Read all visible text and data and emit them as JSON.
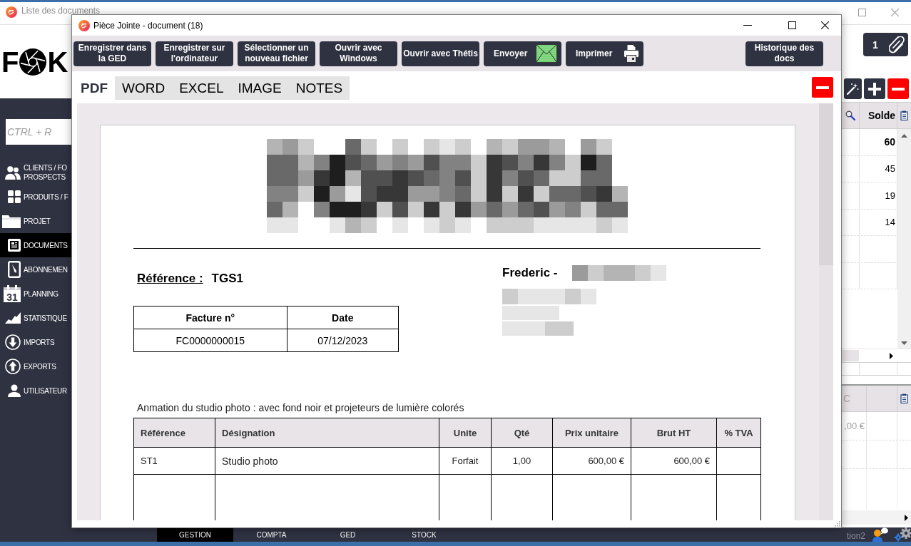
{
  "background_window": {
    "title": "Liste des documents",
    "logo": {
      "text_start": "F",
      "text_end": "K"
    },
    "search": {
      "placeholder": "CTRL + R"
    },
    "sidebar": {
      "items": [
        {
          "label": "CLIENTS / FO\nPROSPECTS",
          "selected": false
        },
        {
          "label": "PRODUITS / F",
          "selected": false
        },
        {
          "label": "PROJET",
          "selected": false
        },
        {
          "label": "DOCUMENTS",
          "selected": true
        },
        {
          "label": "ABONNEMEN",
          "selected": false
        },
        {
          "label": "PLANNING",
          "icon_text": "31",
          "selected": false
        },
        {
          "label": "STATISTIQUE",
          "selected": false
        },
        {
          "label": "IMPORTS",
          "selected": false
        },
        {
          "label": "EXPORTS",
          "selected": false
        },
        {
          "label": "UTILISATEUR",
          "selected": false
        }
      ]
    },
    "attachments_button": {
      "count": "1"
    },
    "grid": {
      "columns": [
        "Solde"
      ],
      "rows": [
        {
          "value": "60",
          "selected": true
        },
        {
          "value": "45",
          "selected": false
        },
        {
          "value": "19",
          "selected": false
        },
        {
          "value": "14",
          "selected": false
        }
      ]
    },
    "lower_grid": {
      "columns": [
        "C"
      ],
      "rows": [
        ",00 €"
      ]
    },
    "bottom_tabs": [
      {
        "label": "GESTION",
        "selected": true
      },
      {
        "label": "COMPTA",
        "selected": false
      },
      {
        "label": "GED",
        "selected": false
      },
      {
        "label": "STOCK",
        "selected": false
      }
    ],
    "status_text": "tion2"
  },
  "dialog": {
    "title": "Pièce Jointe - document (18)",
    "toolbar": {
      "buttons": [
        "Enregistrer dans la GED",
        "Enregistrer sur l'ordinateur",
        "Sélectionner un nouveau fichier",
        "Ouvrir avec Windows",
        "Ouvrir avec Thétis",
        "Envoyer",
        "Imprimer"
      ],
      "history_button": "Historique des docs"
    },
    "tabs": [
      {
        "label": "PDF",
        "selected": true
      },
      {
        "label": "WORD",
        "selected": false
      },
      {
        "label": "EXCEL",
        "selected": false
      },
      {
        "label": "IMAGE",
        "selected": false
      },
      {
        "label": "NOTES",
        "selected": false
      }
    ],
    "document": {
      "reference_label": "Référence :",
      "reference": "TGS1",
      "recipient_name": "Frederic -",
      "invoice_table": {
        "columns": [
          "Facture n°",
          "Date"
        ],
        "rows": [
          [
            "FC0000000015",
            "07/12/2023"
          ]
        ]
      },
      "description": "Anmation du studio photo : avec fond noir et projeteurs de lumière colorés",
      "lines_table": {
        "columns": [
          "Référence",
          "Désignation",
          "Unite",
          "Qté",
          "Prix unitaire",
          "Brut HT",
          "% TVA"
        ],
        "rows": [
          [
            "ST1",
            "Studio photo",
            "Forfait",
            "1,00",
            "600,00 €",
            "600,00 €"
          ]
        ]
      }
    }
  }
}
